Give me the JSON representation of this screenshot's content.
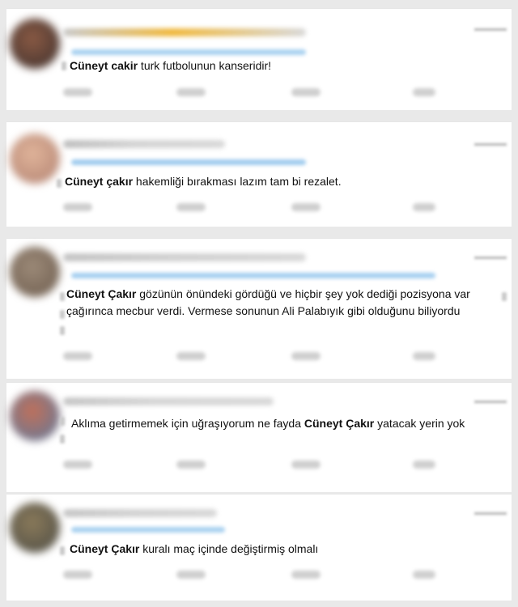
{
  "tweets": [
    {
      "highlight": "Cüneyt cakir",
      "text": " turk futbolunun kanseridir!",
      "avatar_colors": [
        "#3a2e2c",
        "#8a5a44"
      ],
      "handle_colors": [
        "#c9c9c9",
        "#f0b83c"
      ],
      "reply_color": "#a9d1f0"
    },
    {
      "highlight": "Cüneyt çakır",
      "text": " hakemliği bırakması lazım tam bi rezalet.",
      "avatar_colors": [
        "#b08070",
        "#e0b49a"
      ],
      "handle_colors": [
        "#bfbfbf",
        "#d4d4d4"
      ],
      "reply_color": "#9fcbee"
    },
    {
      "highlight": "Cüneyt Çakır",
      "text": " gözünün önündeki gördüğü ve hiçbir şey yok dediği pozisyona var çağırınca mecbur verdi. Vermese sonunun Ali Palabıyık gibi olduğunu biliyordu",
      "avatar_colors": [
        "#6b5a4c",
        "#9c8a78"
      ],
      "handle_colors": [
        "#c4c4c4",
        "#d0d0d0"
      ],
      "reply_color": "#a5cff0"
    },
    {
      "pre": "Aklıma getirmemek için uğraşıyorum ne fayda ",
      "highlight": "Cüneyt Çakır",
      "text": " yatacak yerin yok",
      "avatar_colors": [
        "#5a7aa0",
        "#c0705a"
      ],
      "handle_colors": [
        "#c6c6c6",
        "#d6d6d6"
      ],
      "reply_color": "#c4c4c4"
    },
    {
      "highlight": "Cüneyt Çakır",
      "text": "  kuralı maç içinde değiştirmiş olmalı",
      "avatar_colors": [
        "#4a4a44",
        "#8a7a5a"
      ],
      "handle_colors": [
        "#c6c6c6",
        "#d2d2d2"
      ],
      "reply_color": "#a9d1f0"
    }
  ]
}
